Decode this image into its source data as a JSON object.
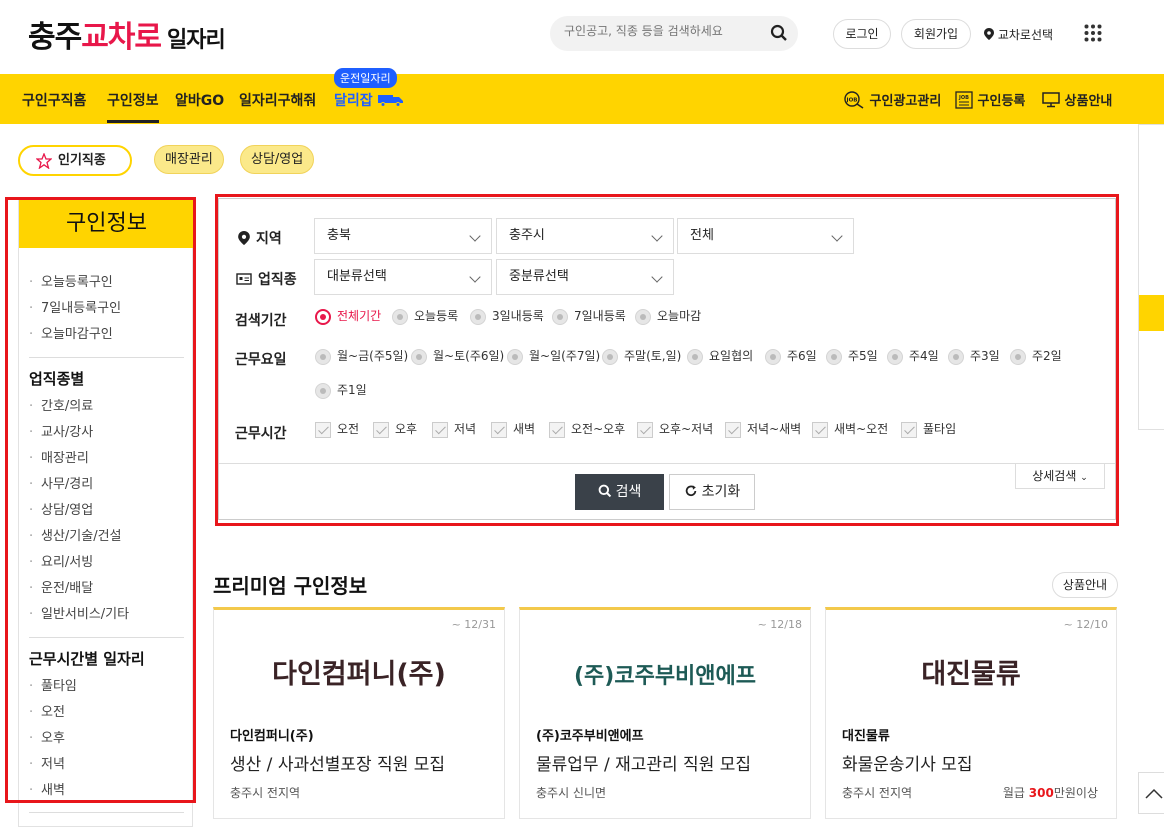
{
  "header": {
    "logo_part1": "충주",
    "logo_part2": "교차로",
    "logo_part3": "일자리",
    "search_placeholder": "구인공고, 직종 등을 검색하세요",
    "login": "로그인",
    "signup": "회원가입",
    "location": "교차로선택"
  },
  "nav": {
    "items": [
      "구인구직홈",
      "구인정보",
      "알바GO",
      "일자리구해줘"
    ],
    "badge": "운전일자리",
    "dalijab": "달리잡",
    "right": [
      "구인광고관리",
      "구인등록",
      "상품안내"
    ]
  },
  "chips": {
    "popular": "인기직종",
    "items": [
      "매장관리",
      "상담/영업"
    ]
  },
  "sidebar": {
    "title": "구인정보",
    "group1": [
      "오늘등록구인",
      "7일내등록구인",
      "오늘마감구인"
    ],
    "head2": "업직종별",
    "group2": [
      "간호/의료",
      "교사/강사",
      "매장관리",
      "사무/경리",
      "상담/영업",
      "생산/기술/건설",
      "요리/서빙",
      "운전/배달",
      "일반서비스/기타"
    ],
    "head3": "근무시간별 일자리",
    "group3": [
      "풀타임",
      "오전",
      "오후",
      "저녁",
      "새벽"
    ]
  },
  "search_panel": {
    "region_label": "지역",
    "region": [
      "충북",
      "충주시",
      "전체"
    ],
    "industry_label": "업직종",
    "industry": [
      "대분류선택",
      "중분류선택"
    ],
    "period_label": "검색기간",
    "period_options": [
      "전체기간",
      "오늘등록",
      "3일내등록",
      "7일내등록",
      "오늘마감"
    ],
    "period_selected": "전체기간",
    "days_label": "근무요일",
    "days_options": [
      "월~금(주5일)",
      "월~토(주6일)",
      "월~일(주7일)",
      "주말(토,일)",
      "요일협의",
      "주6일",
      "주5일",
      "주4일",
      "주3일",
      "주2일",
      "주1일"
    ],
    "time_label": "근무시간",
    "time_options": [
      "오전",
      "오후",
      "저녁",
      "새벽",
      "오전~오후",
      "오후~저녁",
      "저녁~새벽",
      "새벽~오전",
      "풀타임"
    ],
    "detail_search": "상세검색",
    "search_btn": "검색",
    "reset_btn": "초기화"
  },
  "premium": {
    "title": "프리미엄 구인정보",
    "product_btn": "상품안내",
    "cards": [
      {
        "date": "~ 12/31",
        "logo_text": "다인컴퍼니(주)",
        "company": "다인컴퍼니(주)",
        "title": "생산 / 사과선별포장 직원 모집",
        "place": "충주시 전지역",
        "pay_prefix": "",
        "pay_amount": "",
        "pay_suffix": ""
      },
      {
        "date": "~ 12/18",
        "logo_text": "(주)코주부비앤에프",
        "company": "(주)코주부비앤에프",
        "title": "물류업무 / 재고관리 직원 모집",
        "place": "충주시 신니면",
        "pay_prefix": "",
        "pay_amount": "",
        "pay_suffix": ""
      },
      {
        "date": "~ 12/10",
        "logo_text": "대진물류",
        "company": "대진물류",
        "title": "화물운송기사 모집",
        "place": "충주시 전지역",
        "pay_prefix": "월급",
        "pay_amount": "300",
        "pay_suffix": "만원이상"
      }
    ]
  },
  "colors": {
    "brand": "#e8174a",
    "nav_yellow": "#ffd400",
    "highlight_red": "#e8161b",
    "link_blue": "#1f5fff"
  }
}
